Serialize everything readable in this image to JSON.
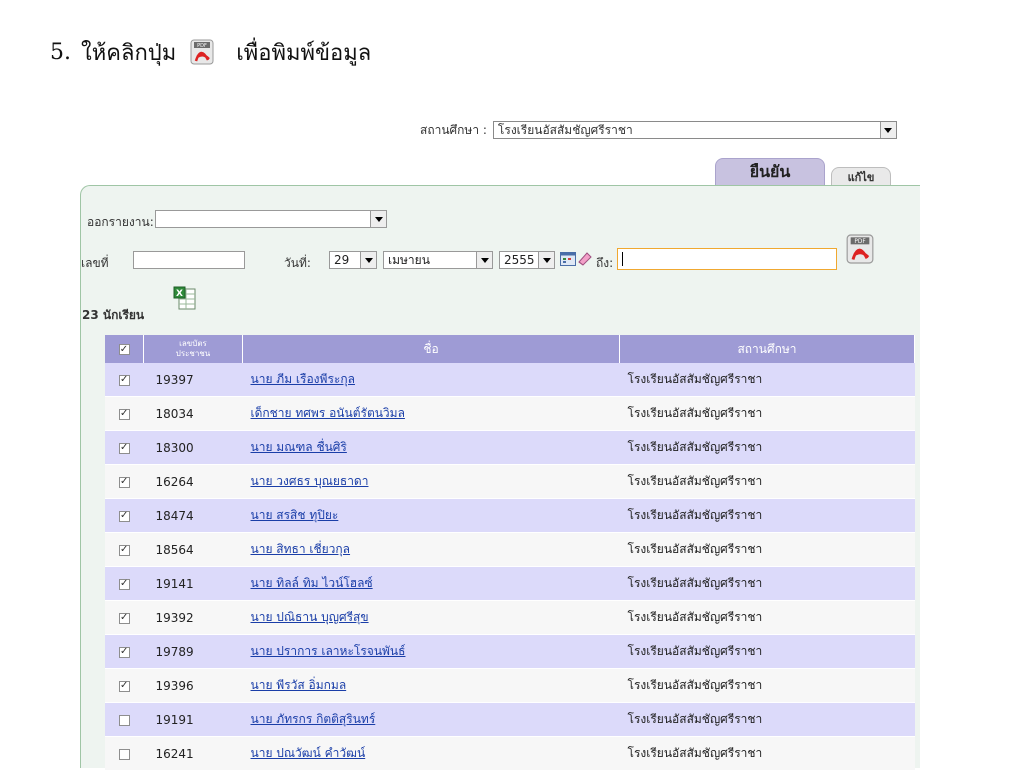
{
  "instruction": {
    "number": "5.",
    "text_before": "ให้คลิกปุ่ม",
    "text_after": "เพื่อพิมพ์ข้อมูล"
  },
  "school": {
    "label": "สถานศึกษา :",
    "value": "โรงเรียนอัสสัมชัญศรีราชา"
  },
  "tabs": {
    "confirm": "ยืนยัน",
    "edit": "แก้ไข"
  },
  "filters": {
    "report_label": "ออกรายงาน:",
    "report_value": "",
    "number_label": "เลขที่",
    "number_value": "",
    "date_label": "วันที่:",
    "day": "29",
    "month": "เมษายน",
    "year": "2555",
    "to_label": "ถึง:",
    "to_value": ""
  },
  "summary": {
    "count_text": "23 นักเรียน"
  },
  "table": {
    "headers": {
      "id_line1": "เลขบัตร",
      "id_line2": "ประชาชน",
      "name": "ชื่อ",
      "school": "สถานศึกษา"
    },
    "header_checked": true,
    "rows": [
      {
        "checked": true,
        "id": "19397",
        "name": "นาย ภีม เรืองพีระกุล",
        "school": "โรงเรียนอัสสัมชัญศรีราชา"
      },
      {
        "checked": true,
        "id": "18034",
        "name": "เด็กชาย ทศพร อนันต์รัตนวิมล",
        "school": "โรงเรียนอัสสัมชัญศรีราชา"
      },
      {
        "checked": true,
        "id": "18300",
        "name": "นาย มณฑล ชื่นศิริ",
        "school": "โรงเรียนอัสสัมชัญศรีราชา"
      },
      {
        "checked": true,
        "id": "16264",
        "name": "นาย วงศธร บุณยธาดา",
        "school": "โรงเรียนอัสสัมชัญศรีราชา"
      },
      {
        "checked": true,
        "id": "18474",
        "name": "นาย สรสิช ทุปิยะ",
        "school": "โรงเรียนอัสสัมชัญศรีราชา"
      },
      {
        "checked": true,
        "id": "18564",
        "name": "นาย สิทธา เชี่ยวกุล",
        "school": "โรงเรียนอัสสัมชัญศรีราชา"
      },
      {
        "checked": true,
        "id": "19141",
        "name": "นาย ทิลล์ ทิม ไวน์โฮลซ์",
        "school": "โรงเรียนอัสสัมชัญศรีราชา"
      },
      {
        "checked": true,
        "id": "19392",
        "name": "นาย ปณิธาน บุญศรีสุข",
        "school": "โรงเรียนอัสสัมชัญศรีราชา"
      },
      {
        "checked": true,
        "id": "19789",
        "name": "นาย ปราการ เลาหะโรจนพันธ์",
        "school": "โรงเรียนอัสสัมชัญศรีราชา"
      },
      {
        "checked": true,
        "id": "19396",
        "name": "นาย พีรวัส อิ่มกมล",
        "school": "โรงเรียนอัสสัมชัญศรีราชา"
      },
      {
        "checked": false,
        "id": "19191",
        "name": "นาย ภัทรกร กิตติสุรินทร์",
        "school": "โรงเรียนอัสสัมชัญศรีราชา"
      },
      {
        "checked": false,
        "id": "16241",
        "name": "นาย ปณวัฒน์ คำวัฒน์",
        "school": "โรงเรียนอัสสัมชัญศรีราชา"
      }
    ]
  },
  "colors": {
    "header_bg": "#9e9bd5",
    "row_odd": "#dcdafa",
    "row_even": "#f7f7f7",
    "link": "#1a3ea8",
    "tab_active": "#c8c2e0",
    "panel_bg": "#eef4f0",
    "panel_border": "#9fc5a5"
  },
  "icons": {
    "pdf": "pdf-icon",
    "excel": "excel-icon",
    "calendar": "calendar-icon",
    "eraser": "eraser-icon"
  }
}
